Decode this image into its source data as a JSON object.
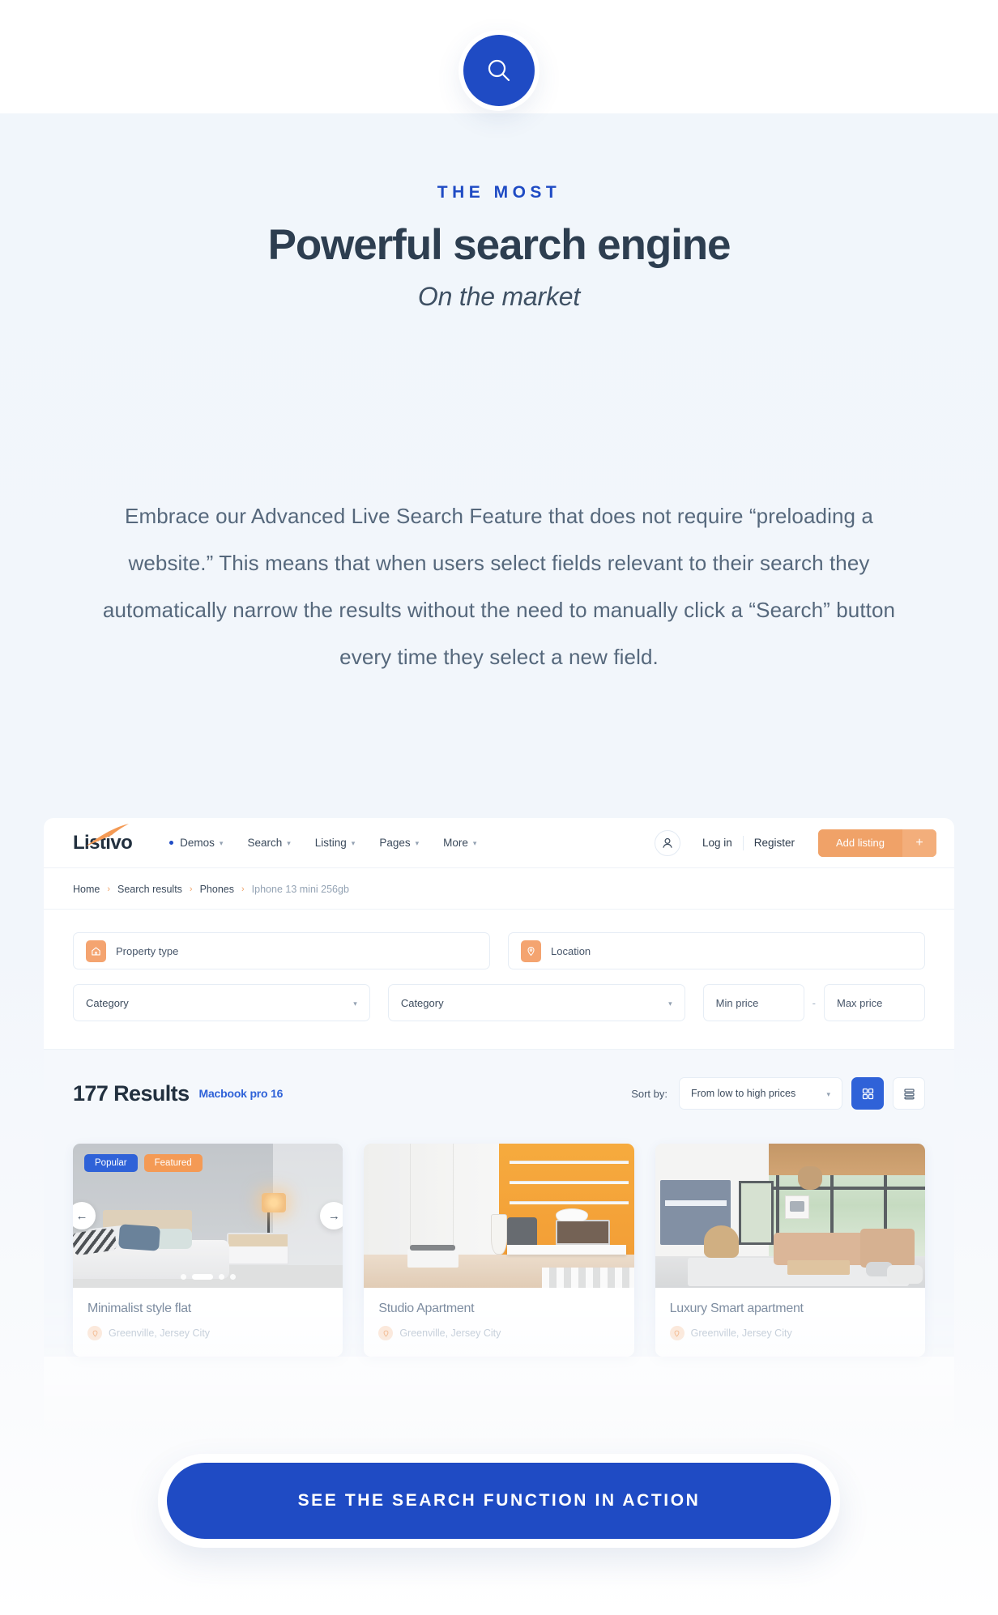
{
  "hero": {
    "search_icon": "search-icon",
    "eyebrow": "THE MOST",
    "title": "Powerful search engine",
    "subtitle": "On the market",
    "paragraph": "Embrace our Advanced Live Search Feature that does not require “preloading a website.”  This means that when users select fields relevant to their search they automatically narrow the results without the need to manually click a “Search” button every time they select a new field."
  },
  "colors": {
    "primary_blue": "#1f4bc4",
    "accent_orange": "#f0a268",
    "badge_blue": "#2f62d8",
    "badge_orange": "#f49a55",
    "page_bg": "#f1f6fb",
    "heading": "#2d3e50",
    "body_text": "#56687c"
  },
  "mockup": {
    "nav": {
      "logo": "Listivo",
      "links": [
        {
          "label": "Demos",
          "has_dot": true,
          "caret": "chevron-down-icon"
        },
        {
          "label": "Search",
          "has_dot": false,
          "caret": "chevron-down-icon"
        },
        {
          "label": "Listing",
          "has_dot": false,
          "caret": "chevron-down-icon"
        },
        {
          "label": "Pages",
          "has_dot": false,
          "caret": "chevron-down-icon"
        },
        {
          "label": "More",
          "has_dot": false,
          "caret": "chevron-down-icon"
        }
      ],
      "avatar_icon": "user-icon",
      "login": "Log in",
      "register": "Register",
      "add_listing": "Add listing",
      "add_listing_plus": "+"
    },
    "breadcrumb": {
      "separator": "›",
      "items": [
        "Home",
        "Search results",
        "Phones",
        "Iphone 13 mini 256gb"
      ]
    },
    "filters": {
      "property_type": {
        "label": "Property type",
        "icon": "home-icon"
      },
      "location": {
        "label": "Location",
        "icon": "map-pin-icon"
      },
      "category_1": {
        "label": "Category",
        "caret": "chevron-down-icon"
      },
      "category_2": {
        "label": "Category",
        "caret": "chevron-down-icon"
      },
      "min_price": "Min price",
      "max_price": "Max price",
      "price_dash": "-"
    },
    "results": {
      "count": "177 Results",
      "query": "Macbook pro 16",
      "sort_label": "Sort by:",
      "sort_value": "From low to high prices",
      "sort_caret": "chevron-down-icon",
      "grid_view_icon": "grid-view-icon",
      "list_view_icon": "list-view-icon"
    },
    "cards": [
      {
        "title": "Minimalist style flat",
        "location": "Greenville, Jersey City",
        "location_icon": "map-pin-icon",
        "badges": [
          "Popular",
          "Featured"
        ],
        "prev_icon": "arrow-left-icon",
        "next_icon": "arrow-right-icon",
        "scene": "bedroom"
      },
      {
        "title": "Studio Apartment",
        "location": "Greenville, Jersey City",
        "location_icon": "map-pin-icon",
        "badges": [],
        "scene": "studio"
      },
      {
        "title": "Luxury Smart apartment",
        "location": "Greenville, Jersey City",
        "location_icon": "map-pin-icon",
        "badges": [],
        "scene": "living-room"
      }
    ]
  },
  "cta": {
    "label": "SEE THE SEARCH FUNCTION IN ACTION"
  }
}
